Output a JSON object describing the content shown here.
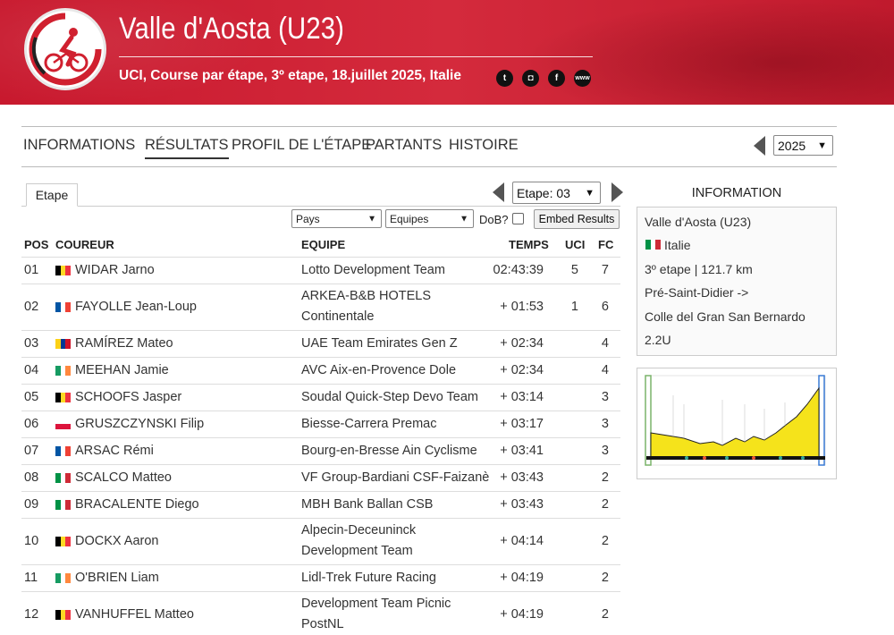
{
  "header": {
    "title": "Valle d'Aosta (U23)",
    "subtitle": "UCI, Course par étape, 3º etape, 18.juillet 2025, Italie",
    "social": [
      {
        "icon": "twitter-icon",
        "glyph": "t"
      },
      {
        "icon": "instagram-icon",
        "glyph": "◘"
      },
      {
        "icon": "facebook-icon",
        "glyph": "f"
      },
      {
        "icon": "website-icon",
        "glyph": "www"
      }
    ],
    "brand_color": "#d0202f"
  },
  "nav": {
    "items": [
      "INFORMATIONS",
      "RÉSULTATS",
      "PROFIL DE L'ÉTAPE",
      "PARTANTS",
      "HISTOIRE"
    ],
    "active": "RÉSULTATS",
    "year": "2025"
  },
  "results": {
    "tab": "Etape",
    "stage_select": "Etape: 03",
    "filters": {
      "country": "Pays",
      "team": "Equipes",
      "dob_label": "DoB?",
      "embed_label": "Embed Results"
    },
    "columns": {
      "pos": "POS",
      "rider": "COUREUR",
      "team": "EQUIPE",
      "time": "TEMPS",
      "uci": "UCI",
      "fc": "FC"
    },
    "rows": [
      {
        "pos": "01",
        "flag": [
          "#000000",
          "#fdda24",
          "#ef3340"
        ],
        "rider": "WIDAR Jarno",
        "team": "Lotto Development Team",
        "team2": "",
        "time": "02:43:39",
        "uci": "5",
        "fc": "7"
      },
      {
        "pos": "02",
        "flag": [
          "#0055a4",
          "#ffffff",
          "#ef4135"
        ],
        "rider": "FAYOLLE Jean-Loup",
        "team": "ARKEA-B&B HOTELS",
        "team2": "Continentale",
        "time": "+ 01:53",
        "uci": "1",
        "fc": "6"
      },
      {
        "pos": "03",
        "flag": [
          "#fcd116",
          "#003893",
          "#ce1126"
        ],
        "rider": "RAMÍREZ Mateo",
        "team": "UAE Team Emirates Gen Z",
        "team2": "",
        "time": "+ 02:34",
        "uci": "",
        "fc": "4"
      },
      {
        "pos": "04",
        "flag": [
          "#169b62",
          "#ffffff",
          "#ff883e"
        ],
        "rider": "MEEHAN Jamie",
        "team": "AVC Aix-en-Provence Dole",
        "team2": "",
        "time": "+ 02:34",
        "uci": "",
        "fc": "4"
      },
      {
        "pos": "05",
        "flag": [
          "#000000",
          "#fdda24",
          "#ef3340"
        ],
        "rider": "SCHOOFS Jasper",
        "team": "Soudal Quick-Step Devo Team",
        "team2": "",
        "time": "+ 03:14",
        "uci": "",
        "fc": "3"
      },
      {
        "pos": "06",
        "flag": [
          "#ffffff",
          "#dc143c"
        ],
        "rider": "GRUSZCZYNSKI Filip",
        "team": "Biesse-Carrera Premac",
        "team2": "",
        "time": "+ 03:17",
        "uci": "",
        "fc": "3"
      },
      {
        "pos": "07",
        "flag": [
          "#0055a4",
          "#ffffff",
          "#ef4135"
        ],
        "rider": "ARSAC Rémi",
        "team": "Bourg-en-Bresse Ain Cyclisme",
        "team2": "",
        "time": "+ 03:41",
        "uci": "",
        "fc": "3"
      },
      {
        "pos": "08",
        "flag": [
          "#009246",
          "#ffffff",
          "#ce2b37"
        ],
        "rider": "SCALCO Matteo",
        "team": "VF Group-Bardiani CSF-Faizanè",
        "team2": "",
        "time": "+ 03:43",
        "uci": "",
        "fc": "2"
      },
      {
        "pos": "09",
        "flag": [
          "#009246",
          "#ffffff",
          "#ce2b37"
        ],
        "rider": "BRACALENTE Diego",
        "team": "MBH Bank Ballan CSB",
        "team2": "",
        "time": "+ 03:43",
        "uci": "",
        "fc": "2"
      },
      {
        "pos": "10",
        "flag": [
          "#000000",
          "#fdda24",
          "#ef3340"
        ],
        "rider": "DOCKX Aaron",
        "team": "Alpecin-Deceuninck",
        "team2": "Development Team",
        "time": "+ 04:14",
        "uci": "",
        "fc": "2"
      },
      {
        "pos": "11",
        "flag": [
          "#169b62",
          "#ffffff",
          "#ff883e"
        ],
        "rider": "O'BRIEN Liam",
        "team": "Lidl-Trek Future Racing",
        "team2": "",
        "time": "+ 04:19",
        "uci": "",
        "fc": "2"
      },
      {
        "pos": "12",
        "flag": [
          "#000000",
          "#fdda24",
          "#ef3340"
        ],
        "rider": "VANHUFFEL Matteo",
        "team": "Development Team Picnic",
        "team2": "PostNL",
        "time": "+ 04:19",
        "uci": "",
        "fc": "2"
      }
    ]
  },
  "info": {
    "heading": "INFORMATION",
    "race": "Valle d'Aosta (U23)",
    "country": "Italie",
    "stage": "3º etape | 121.7 km",
    "from": "Pré-Saint-Didier ->",
    "to": "Colle del Gran San Bernardo",
    "category": "2.2U"
  }
}
